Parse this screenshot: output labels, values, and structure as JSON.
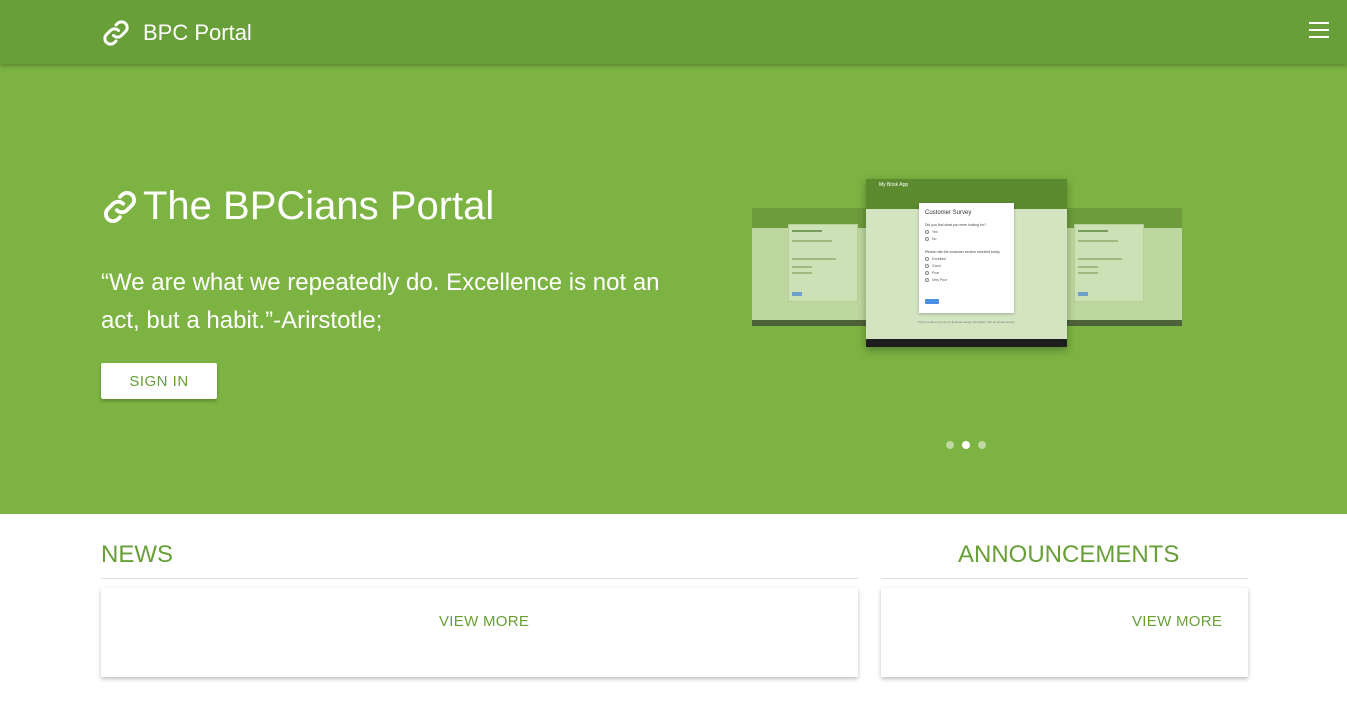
{
  "navbar": {
    "brand_icon": "link-icon",
    "brand_label": "BPC Portal",
    "menu_icon": "hamburger-menu-icon"
  },
  "hero": {
    "title_icon": "link-icon",
    "title": "The BPCians Portal",
    "quote": "“We are what we repeatedly do. Excellence is not an act, but a habit.”-Arirstotle;",
    "signin_label": "SIGN IN",
    "carousel": {
      "main_slide": {
        "app_title": "My Brisk App",
        "survey_title": "Customer Survey",
        "question_1": "Did you find what you were looking for?",
        "q1_options": [
          "Yes",
          "No"
        ],
        "question_2": "Please rate the customer service received today",
        "q2_options": [
          "Excellent",
          "Good",
          "Poor",
          "Very Poor"
        ],
        "submit_label": "Submit",
        "footer_note": "This is a demo survey to illustrate design principles. Not an actual survey."
      },
      "side_slide_title": "Customer Survey",
      "dots": [
        false,
        true,
        false
      ]
    }
  },
  "colors": {
    "navbar": "#689f38",
    "hero": "#7cb342",
    "accent": "#689f38"
  },
  "news": {
    "title": "NEWS",
    "view_more_label": "VIEW MORE"
  },
  "announcements": {
    "title": "ANNOUNCEMENTS",
    "view_more_label": "VIEW MORE"
  }
}
